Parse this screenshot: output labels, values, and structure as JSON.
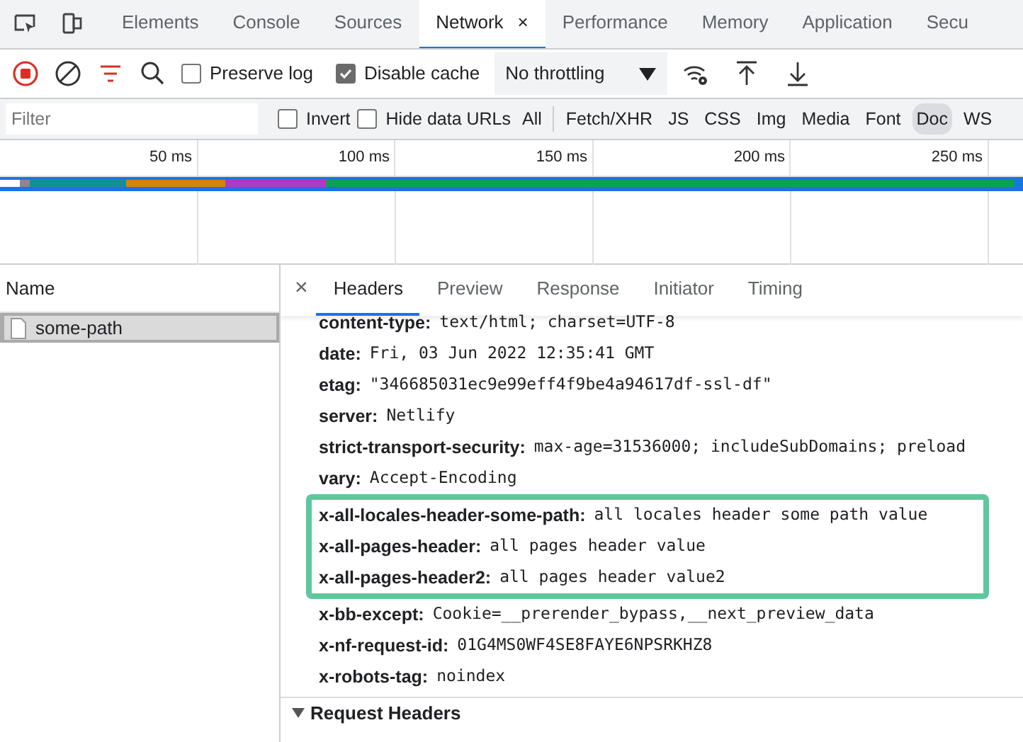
{
  "panel_tabs": [
    {
      "label": "Elements",
      "selected": false
    },
    {
      "label": "Console",
      "selected": false
    },
    {
      "label": "Sources",
      "selected": false
    },
    {
      "label": "Network",
      "selected": true,
      "close": "×"
    },
    {
      "label": "Performance",
      "selected": false
    },
    {
      "label": "Memory",
      "selected": false
    },
    {
      "label": "Application",
      "selected": false
    },
    {
      "label": "Secu",
      "selected": false
    }
  ],
  "toolbar": {
    "recording": true,
    "filter_active": true,
    "checkboxes": [
      {
        "label": "Preserve log",
        "checked": false
      },
      {
        "label": "Disable cache",
        "checked": true
      }
    ],
    "throttling": "No throttling"
  },
  "filter_bar": {
    "placeholder": "Filter",
    "checkboxes": [
      {
        "label": "Invert",
        "checked": false
      },
      {
        "label": "Hide data URLs",
        "checked": false
      }
    ],
    "types": [
      {
        "label": "All",
        "selected": false
      },
      {
        "label": "Fetch/XHR",
        "selected": false
      },
      {
        "label": "JS",
        "selected": false
      },
      {
        "label": "CSS",
        "selected": false
      },
      {
        "label": "Img",
        "selected": false
      },
      {
        "label": "Media",
        "selected": false
      },
      {
        "label": "Font",
        "selected": false
      },
      {
        "label": "Doc",
        "selected": true
      },
      {
        "label": "WS",
        "selected": false
      }
    ]
  },
  "timeline": {
    "ticks": [
      "50 ms",
      "100 ms",
      "150 ms",
      "200 ms",
      "250 ms"
    ]
  },
  "requests": {
    "column": "Name",
    "rows": [
      {
        "name": "some-path",
        "selected": true
      }
    ]
  },
  "detail_tabs": [
    {
      "label": "Headers",
      "selected": true
    },
    {
      "label": "Preview",
      "selected": false
    },
    {
      "label": "Response",
      "selected": false
    },
    {
      "label": "Initiator",
      "selected": false
    },
    {
      "label": "Timing",
      "selected": false
    }
  ],
  "close": "×",
  "headers": [
    {
      "name": "content-type:",
      "value": "text/html; charset=UTF-8",
      "highlighted": false
    },
    {
      "name": "date:",
      "value": "Fri, 03 Jun 2022 12:35:41 GMT",
      "highlighted": false
    },
    {
      "name": "etag:",
      "value": "\"346685031ec9e99eff4f9be4a94617df-ssl-df\"",
      "highlighted": false
    },
    {
      "name": "server:",
      "value": "Netlify",
      "highlighted": false
    },
    {
      "name": "strict-transport-security:",
      "value": "max-age=31536000; includeSubDomains; preload",
      "highlighted": false
    },
    {
      "name": "vary:",
      "value": "Accept-Encoding",
      "highlighted": false
    },
    {
      "name": "x-all-locales-header-some-path:",
      "value": "all locales header some path value",
      "highlighted": true
    },
    {
      "name": "x-all-pages-header:",
      "value": "all pages header value",
      "highlighted": true
    },
    {
      "name": "x-all-pages-header2:",
      "value": "all pages header value2",
      "highlighted": true
    },
    {
      "name": "x-bb-except:",
      "value": "Cookie=__prerender_bypass,__next_preview_data",
      "highlighted": false
    },
    {
      "name": "x-nf-request-id:",
      "value": "01G4MS0WF4SE8FAYE6NPSRKHZ8",
      "highlighted": false
    },
    {
      "name": "x-robots-tag:",
      "value": "noindex",
      "highlighted": false
    }
  ],
  "next_section": {
    "title": "Request Headers",
    "expanded": true
  }
}
